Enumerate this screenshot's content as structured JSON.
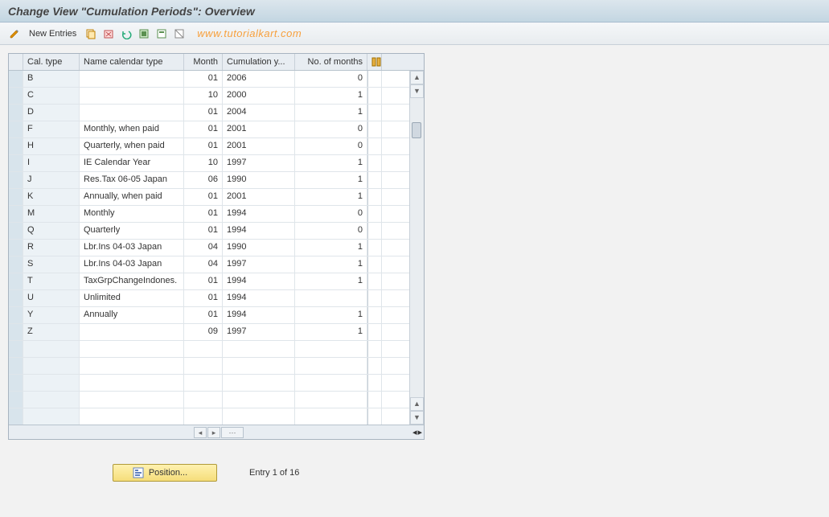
{
  "title": "Change View \"Cumulation Periods\": Overview",
  "toolbar": {
    "new_entries": "New Entries"
  },
  "watermark": "www.tutorialkart.com",
  "columns": {
    "cal_type": "Cal. type",
    "name_cal": "Name calendar type",
    "month": "Month",
    "cumul_y": "Cumulation y...",
    "months": "No. of months"
  },
  "rows": [
    {
      "cal": "B",
      "name": "",
      "month": "01",
      "year": "2006",
      "months": "0"
    },
    {
      "cal": "C",
      "name": "",
      "month": "10",
      "year": "2000",
      "months": "1"
    },
    {
      "cal": "D",
      "name": "",
      "month": "01",
      "year": "2004",
      "months": "1"
    },
    {
      "cal": "F",
      "name": "Monthly, when paid",
      "month": "01",
      "year": "2001",
      "months": "0"
    },
    {
      "cal": "H",
      "name": "Quarterly, when paid",
      "month": "01",
      "year": "2001",
      "months": "0"
    },
    {
      "cal": "I",
      "name": "IE Calendar Year",
      "month": "10",
      "year": "1997",
      "months": "1"
    },
    {
      "cal": "J",
      "name": "Res.Tax 06-05  Japan",
      "month": "06",
      "year": "1990",
      "months": "1"
    },
    {
      "cal": "K",
      "name": "Annually, when paid",
      "month": "01",
      "year": "2001",
      "months": "1"
    },
    {
      "cal": "M",
      "name": "Monthly",
      "month": "01",
      "year": "1994",
      "months": "0"
    },
    {
      "cal": "Q",
      "name": "Quarterly",
      "month": "01",
      "year": "1994",
      "months": "0"
    },
    {
      "cal": "R",
      "name": "Lbr.Ins 04-03  Japan",
      "month": "04",
      "year": "1990",
      "months": "1"
    },
    {
      "cal": "S",
      "name": "Lbr.Ins 04-03  Japan",
      "month": "04",
      "year": "1997",
      "months": "1"
    },
    {
      "cal": "T",
      "name": "TaxGrpChangeIndones.",
      "month": "01",
      "year": "1994",
      "months": "1"
    },
    {
      "cal": "U",
      "name": "Unlimited",
      "month": "01",
      "year": "1994",
      "months": ""
    },
    {
      "cal": "Y",
      "name": "Annually",
      "month": "01",
      "year": "1994",
      "months": "1"
    },
    {
      "cal": "Z",
      "name": "",
      "month": "09",
      "year": "1997",
      "months": "1"
    }
  ],
  "empty_rows": 5,
  "position_button": "Position...",
  "entry_status": "Entry 1 of 16"
}
